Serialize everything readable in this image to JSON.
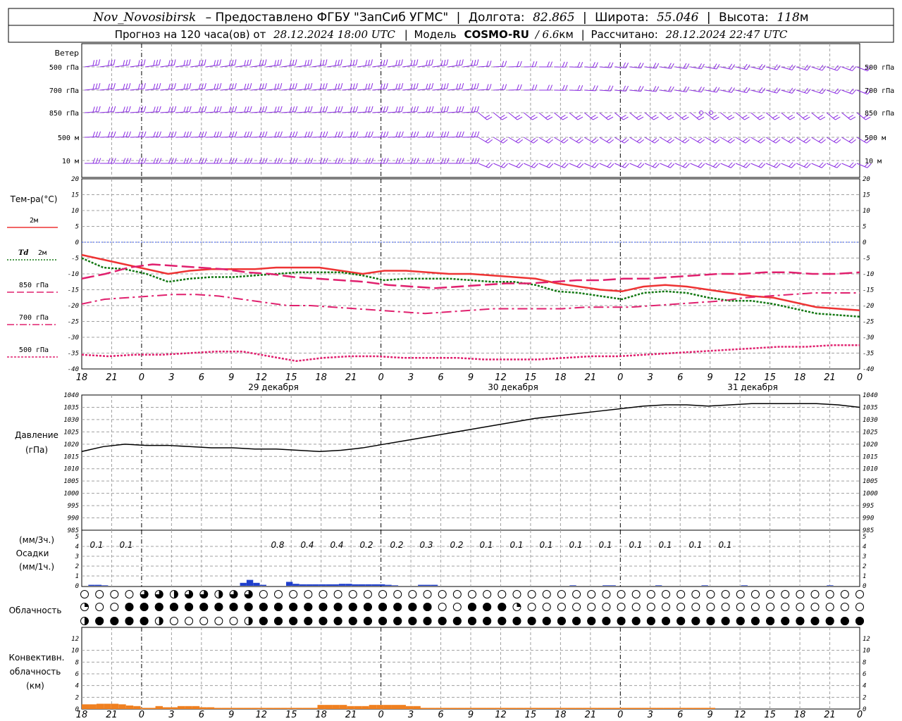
{
  "header": {
    "station": "Nov_Novosibirsk",
    "provider": "– Предоставлено ФГБУ \"ЗапСиб УГМС\"",
    "lon_label": "Долгота:",
    "lon_value": "82.865",
    "lat_label": "Широта:",
    "lat_value": "55.046",
    "alt_label": "Высота:",
    "alt_value": "118",
    "alt_unit": "м",
    "forecast_prefix": "Прогноз на 120 часа(ов) от",
    "forecast_start": "28.12.2024 18:00 UTC",
    "model_label": "Модель",
    "model_name": "COSMO-RU",
    "model_res": "/ 6.6",
    "model_res_unit": "км",
    "calc_label": "Рассчитано:",
    "calc_time": "28.12.2024 22:47 UTC"
  },
  "colors": {
    "wind": "#8a2be2",
    "t2m": "#ee3333",
    "td2m": "#117711",
    "t850": "#e0206e",
    "t700": "#e0206e",
    "t500": "#e0206e",
    "pressure": "#000000",
    "precip": "#1f3fcc",
    "convective": "#f08020",
    "grid": "#a0a0a0"
  },
  "time_ticks": [
    "18",
    "21",
    "0",
    "3",
    "6",
    "9",
    "12",
    "15",
    "18",
    "21",
    "0",
    "3",
    "6",
    "9",
    "12",
    "15",
    "18",
    "21",
    "0",
    "3",
    "6",
    "9",
    "12",
    "15",
    "18",
    "21",
    "0"
  ],
  "day_labels": [
    "29 декабря",
    "30 декабря",
    "31 декабря"
  ],
  "wind_panel": {
    "title": "Ветер",
    "levels": [
      "500 гПа",
      "700 гПа",
      "850 гПа",
      "500 м",
      "10 м"
    ]
  },
  "temp_panel": {
    "title": "Тем-ра(°C)",
    "yticks": [
      "20",
      "15",
      "10",
      "5",
      "0",
      "-5",
      "-10",
      "-15",
      "-20",
      "-25",
      "-30",
      "-35",
      "-40"
    ],
    "legend": {
      "t2m": "2м",
      "td_symbol": "Td",
      "td2m": "2м",
      "t850": "850 гПа",
      "t700": "700 гПа",
      "t500": "500 гПа"
    }
  },
  "pressure_panel": {
    "title": "Давление",
    "unit": "(гПа)",
    "yticks": [
      "1040",
      "1035",
      "1030",
      "1025",
      "1020",
      "1015",
      "1010",
      "1005",
      "1000",
      "995",
      "990",
      "985"
    ]
  },
  "precip_panel": {
    "unit3": "(мм/3ч.)",
    "title": "Осадки",
    "unit1": "(мм/1ч.)",
    "yticks": [
      "5",
      "4",
      "3",
      "2",
      "1",
      "0"
    ]
  },
  "cloud_panel": {
    "title": "Облачность"
  },
  "conv_panel": {
    "title1": "Конвективн.",
    "title2": "облачность",
    "unit": "(км)",
    "yticks": [
      "12",
      "10",
      "8",
      "6",
      "4",
      "2",
      "0"
    ]
  },
  "chart_data": [
    {
      "type": "line",
      "title": "Тем-ра(°C)",
      "x": [
        "18",
        "21",
        "0",
        "3",
        "6",
        "9",
        "12",
        "15",
        "18",
        "21",
        "0",
        "3",
        "6",
        "9",
        "12",
        "15",
        "18",
        "21",
        "0",
        "3",
        "6",
        "9",
        "12",
        "15",
        "18",
        "21",
        "0"
      ],
      "ylim": [
        -40,
        20
      ],
      "series": [
        {
          "name": "2м",
          "values": [
            -4,
            -5.5,
            -7,
            -8.5,
            -10,
            -9,
            -8.5,
            -8.5,
            -8.5,
            -8,
            -8,
            -8,
            -9,
            -10,
            -9,
            -9,
            -9.5,
            -10,
            -10,
            -10.5,
            -11,
            -11.5,
            -13,
            -14,
            -15,
            -15.5,
            -14,
            -13.5,
            -14,
            -15,
            -16,
            -17,
            -17.5,
            -19,
            -20.5,
            -21,
            -21.5
          ]
        },
        {
          "name": "Td 2м",
          "values": [
            -5,
            -8,
            -8.5,
            -10,
            -12.5,
            -11.5,
            -11,
            -11,
            -10.5,
            -10,
            -9.5,
            -9.5,
            -9.5,
            -10.5,
            -12,
            -11.5,
            -11.5,
            -11.5,
            -12,
            -12.5,
            -12.5,
            -13.5,
            -15.5,
            -16,
            -17,
            -18,
            -16,
            -15.5,
            -16,
            -17.5,
            -18.5,
            -18.5,
            -19.5,
            -21,
            -22.5,
            -23,
            -23.5
          ]
        },
        {
          "name": "850 гПа",
          "values": [
            -11.5,
            -10,
            -8,
            -7,
            -7.5,
            -8,
            -8.5,
            -9.5,
            -10,
            -11,
            -11.5,
            -12,
            -12.5,
            -13.5,
            -14,
            -14.5,
            -14,
            -13.5,
            -13,
            -13,
            -12.5,
            -12,
            -12,
            -11.5,
            -11.5,
            -11,
            -10.5,
            -10,
            -10,
            -9.5,
            -9.5,
            -10,
            -10,
            -9.5
          ]
        },
        {
          "name": "700 гПа",
          "values": [
            -19.5,
            -18,
            -17.5,
            -17,
            -16.5,
            -16.5,
            -17,
            -18,
            -19,
            -20,
            -20,
            -20.5,
            -21,
            -21.5,
            -22,
            -22.5,
            -22,
            -21.5,
            -21,
            -21,
            -21,
            -21,
            -20.5,
            -20.5,
            -20.5,
            -20,
            -19.5,
            -19,
            -18.5,
            -17.5,
            -17,
            -16.5,
            -16,
            -16,
            -16
          ]
        },
        {
          "name": "500 гПа",
          "values": [
            -35.5,
            -36,
            -35.5,
            -35.5,
            -35,
            -34.5,
            -34.5,
            -36,
            -37.5,
            -36.5,
            -36,
            -36,
            -36.5,
            -36.5,
            -36.5,
            -37,
            -37,
            -37,
            -36.5,
            -36,
            -36,
            -35.5,
            -35,
            -34.5,
            -34,
            -33.5,
            -33,
            -33,
            -32.5,
            -32.5
          ]
        }
      ]
    },
    {
      "type": "line",
      "title": "Давление",
      "ylabel": "(гПа)",
      "ylim": [
        985,
        1040
      ],
      "series": [
        {
          "name": "Давление",
          "values": [
            1017,
            1019,
            1020,
            1019.5,
            1019.5,
            1019,
            1018.5,
            1018.5,
            1018,
            1018,
            1017.5,
            1017,
            1017.5,
            1018.5,
            1020,
            1021.5,
            1023,
            1024.5,
            1026,
            1027.5,
            1029,
            1030.5,
            1031.5,
            1032.5,
            1033.5,
            1034.5,
            1035.5,
            1036,
            1036,
            1035.5,
            1036,
            1036.5,
            1036.5,
            1036.5,
            1036.5,
            1036,
            1035
          ]
        }
      ]
    },
    {
      "type": "bar",
      "title": "Осадки",
      "ylabel": "(мм/1ч.)",
      "ylim": [
        0,
        5
      ],
      "labels": [
        "0.1",
        "0.1",
        "0.8",
        "0.4",
        "0.4",
        "0.2",
        "0.2",
        "0.3",
        "0.2",
        "0.1",
        "0.1",
        "0.1",
        "0.1",
        "0.1",
        "0.1",
        "0.1",
        "0.1",
        "0.1"
      ],
      "values": [
        0,
        0.1,
        0.1,
        0.05,
        0,
        0,
        0,
        0,
        0,
        0,
        0,
        0,
        0,
        0,
        0,
        0,
        0,
        0,
        0,
        0,
        0,
        0,
        0,
        0,
        0.3,
        0.6,
        0.3,
        0.1,
        0,
        0,
        0,
        0.4,
        0.2,
        0.15,
        0.15,
        0.15,
        0.15,
        0.15,
        0.15,
        0.2,
        0.2,
        0.15,
        0.15,
        0.15,
        0.15,
        0.15,
        0.1,
        0.05,
        0,
        0,
        0,
        0.1,
        0.1,
        0.1,
        0,
        0,
        0,
        0,
        0,
        0,
        0,
        0,
        0,
        0,
        0,
        0,
        0,
        0,
        0,
        0,
        0,
        0,
        0,
        0,
        0.05,
        0,
        0,
        0,
        0,
        0.05,
        0.05,
        0,
        0,
        0,
        0,
        0,
        0,
        0.05,
        0,
        0,
        0,
        0,
        0,
        0,
        0.05,
        0,
        0,
        0,
        0,
        0,
        0.05,
        0,
        0,
        0,
        0,
        0,
        0,
        0,
        0,
        0,
        0,
        0,
        0,
        0.05,
        0,
        0,
        0,
        0
      ]
    },
    {
      "type": "bar",
      "title": "Конвективн. облачность",
      "ylabel": "(км)",
      "ylim": [
        0,
        13
      ],
      "values": [
        0.8,
        0.8,
        0.9,
        0.9,
        0.9,
        0.8,
        0.6,
        0.5,
        0.2,
        0.2,
        0.5,
        0.3,
        0.3,
        0.5,
        0.5,
        0.5,
        0.3,
        0.3,
        0.2,
        0.2,
        0.2,
        0.2,
        0.2,
        0.2,
        0.2,
        0.2,
        0.2,
        0.2,
        0.2,
        0.2,
        0.2,
        0.2,
        0.7,
        0.7,
        0.7,
        0.7,
        0.5,
        0.5,
        0.5,
        0.7,
        0.7,
        0.7,
        0.7,
        0.7,
        0.5,
        0.5,
        0.2,
        0.2,
        0.2,
        0.2,
        0.2,
        0.2,
        0.2,
        0.2,
        0.2,
        0.2,
        0.2,
        0.2,
        0.2,
        0.2,
        0.2,
        0.2,
        0.2,
        0.2,
        0.2,
        0.2,
        0.2,
        0.2,
        0.2,
        0.2,
        0.2,
        0.2,
        0.2,
        0.2,
        0.2,
        0.2,
        0.2,
        0.2,
        0.2,
        0.2,
        0.2,
        0.2,
        0.2,
        0.2,
        0.2,
        0.2
      ]
    }
  ]
}
